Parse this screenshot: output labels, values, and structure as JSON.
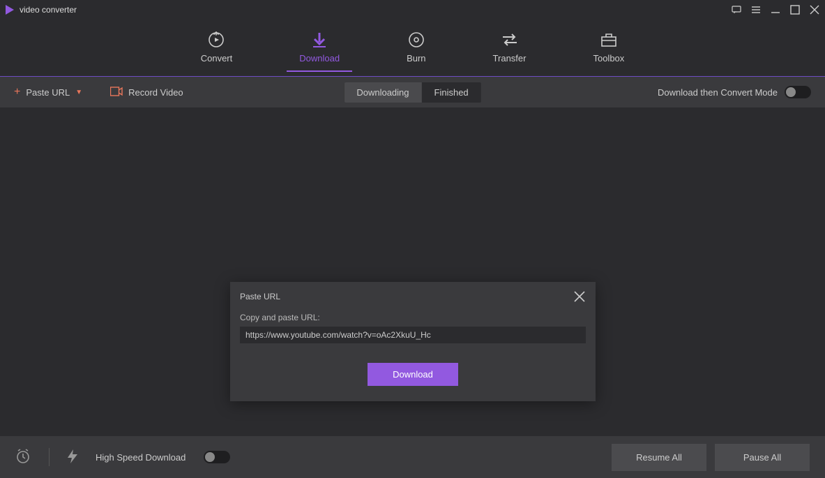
{
  "app": {
    "title": "video converter"
  },
  "nav": {
    "convert": "Convert",
    "download": "Download",
    "burn": "Burn",
    "transfer": "Transfer",
    "toolbox": "Toolbox"
  },
  "subbar": {
    "paste_url": "Paste URL",
    "record_video": "Record Video",
    "tab_downloading": "Downloading",
    "tab_finished": "Finished",
    "convert_mode_label": "Download then Convert Mode"
  },
  "modal": {
    "title": "Paste URL",
    "label": "Copy and paste URL:",
    "url_value": "https://www.youtube.com/watch?v=oAc2XkuU_Hc",
    "download_btn": "Download"
  },
  "footer": {
    "high_speed": "High Speed Download",
    "resume_all": "Resume All",
    "pause_all": "Pause All"
  }
}
